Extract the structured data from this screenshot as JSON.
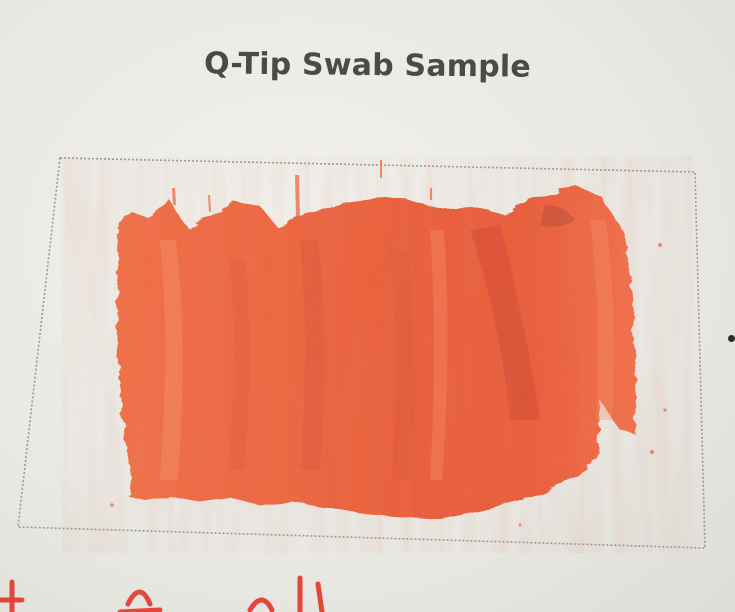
{
  "page": {
    "title": "Q-Tip Swab Sample"
  },
  "colors": {
    "paper": "#ecebe6",
    "ink_orange": "#ee6a43",
    "ink_orange_dark": "#d9553a",
    "ink_orange_light": "#f58a62",
    "pencil_frame": "#8c8c88",
    "title_text": "#4a4a48",
    "handwriting_red": "#e2473a"
  },
  "elements": {
    "swab": "orange-ink-swatch",
    "frame": "pencil-dotted-rectangle",
    "handwriting": "red-handwritten-text-partial"
  }
}
